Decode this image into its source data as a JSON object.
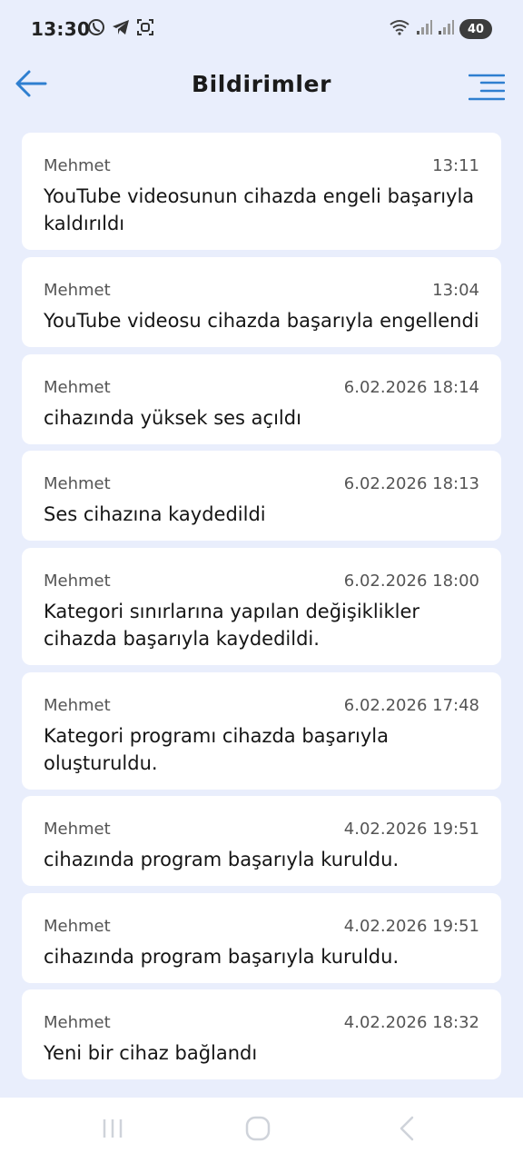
{
  "status_bar": {
    "time": "13:30",
    "battery": "40",
    "left_icons": [
      "viber-icon",
      "telegram-icon",
      "screen-capture-icon"
    ],
    "right_icons": [
      "wifi-icon",
      "signal-icon",
      "signal-icon",
      "battery-icon"
    ]
  },
  "header": {
    "title": "Bildirimler",
    "back_icon": "arrow-left-icon",
    "menu_icon": "menu-lines-icon"
  },
  "colors": {
    "background": "#e9eefc",
    "accent": "#2f7fd0",
    "card": "#ffffff"
  },
  "notifications": [
    {
      "sender": "Mehmet",
      "time": "13:11",
      "message": "YouTube videosunun cihazda engeli başarıyla kaldırıldı"
    },
    {
      "sender": "Mehmet",
      "time": "13:04",
      "message": "YouTube videosu cihazda başarıyla engellendi"
    },
    {
      "sender": "Mehmet",
      "time": "6.02.2026 18:14",
      "message": "cihazında yüksek ses açıldı"
    },
    {
      "sender": "Mehmet",
      "time": "6.02.2026 18:13",
      "message": "Ses cihazına kaydedildi"
    },
    {
      "sender": "Mehmet",
      "time": "6.02.2026 18:00",
      "message": "Kategori sınırlarına yapılan değişiklikler cihazda başarıyla kaydedildi."
    },
    {
      "sender": "Mehmet",
      "time": "6.02.2026 17:48",
      "message": "Kategori programı cihazda başarıyla oluşturuldu."
    },
    {
      "sender": "Mehmet",
      "time": "4.02.2026 19:51",
      "message": "cihazında program başarıyla kuruldu."
    },
    {
      "sender": "Mehmet",
      "time": "4.02.2026 19:51",
      "message": "cihazında program başarıyla kuruldu."
    },
    {
      "sender": "Mehmet",
      "time": "4.02.2026 18:32",
      "message": "Yeni bir cihaz bağlandı"
    }
  ],
  "nav_bar": {
    "icons": [
      "recent-apps-icon",
      "home-icon",
      "back-icon"
    ]
  }
}
